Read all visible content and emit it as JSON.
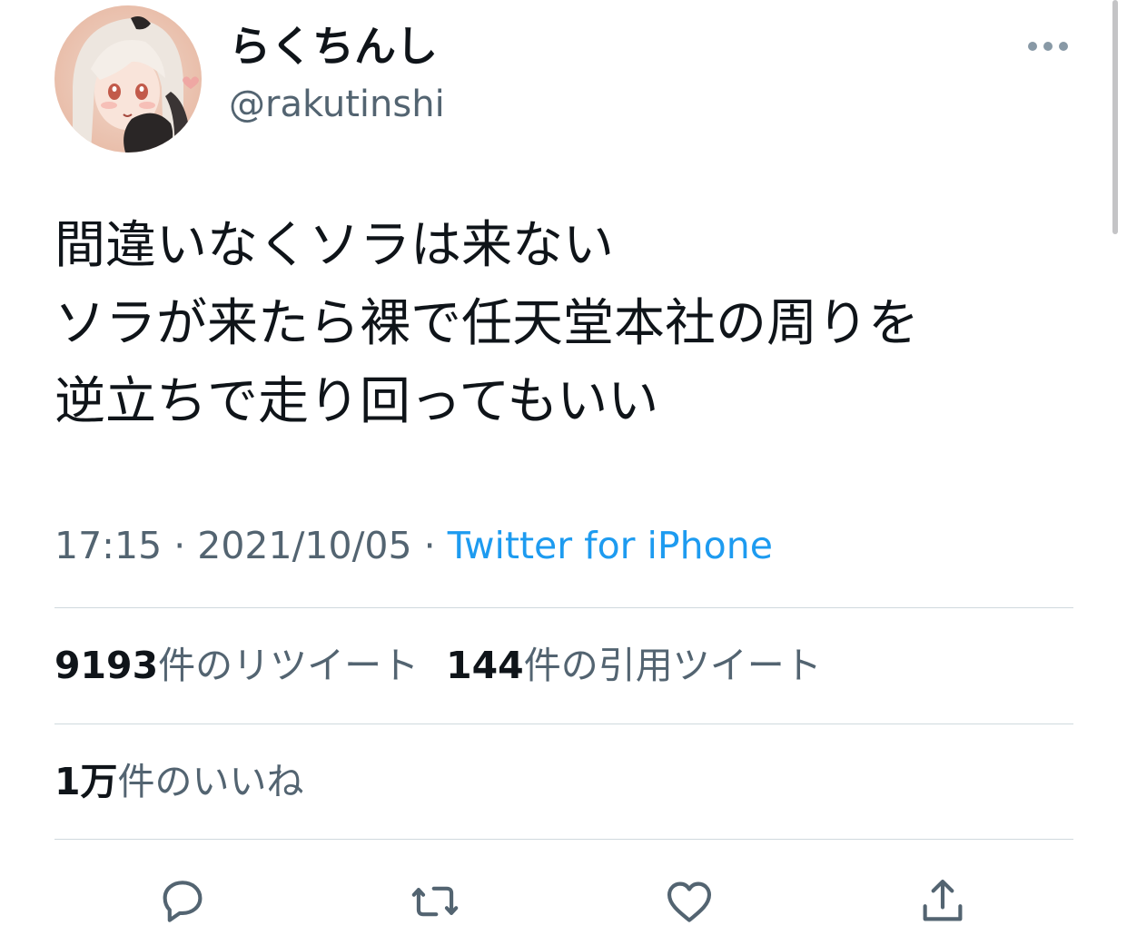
{
  "user": {
    "display_name": "らくちんし",
    "handle": "@rakutinshi",
    "avatar_icon": "avatar-illustration"
  },
  "tweet": {
    "lines": [
      "間違いなくソラは来ない",
      "ソラが来たら裸で任天堂本社の周りを",
      "逆立ちで走り回ってもいい"
    ]
  },
  "meta": {
    "time": "17:15",
    "separator": " · ",
    "date": "2021/10/05",
    "source": "Twitter for iPhone"
  },
  "stats": {
    "retweets_count": "9193",
    "retweets_label": "件のリツイート",
    "quotes_count": "144",
    "quotes_label": "件の引用ツイート",
    "likes_count": "1万",
    "likes_label": "件のいいね"
  },
  "actions": {
    "reply_icon": "reply-icon",
    "retweet_icon": "retweet-icon",
    "like_icon": "heart-icon",
    "share_icon": "share-icon",
    "more_icon": "more-icon"
  },
  "colors": {
    "text_primary": "#0f1419",
    "text_secondary": "#536471",
    "link": "#1d9bf0",
    "divider": "#cfd9de"
  }
}
